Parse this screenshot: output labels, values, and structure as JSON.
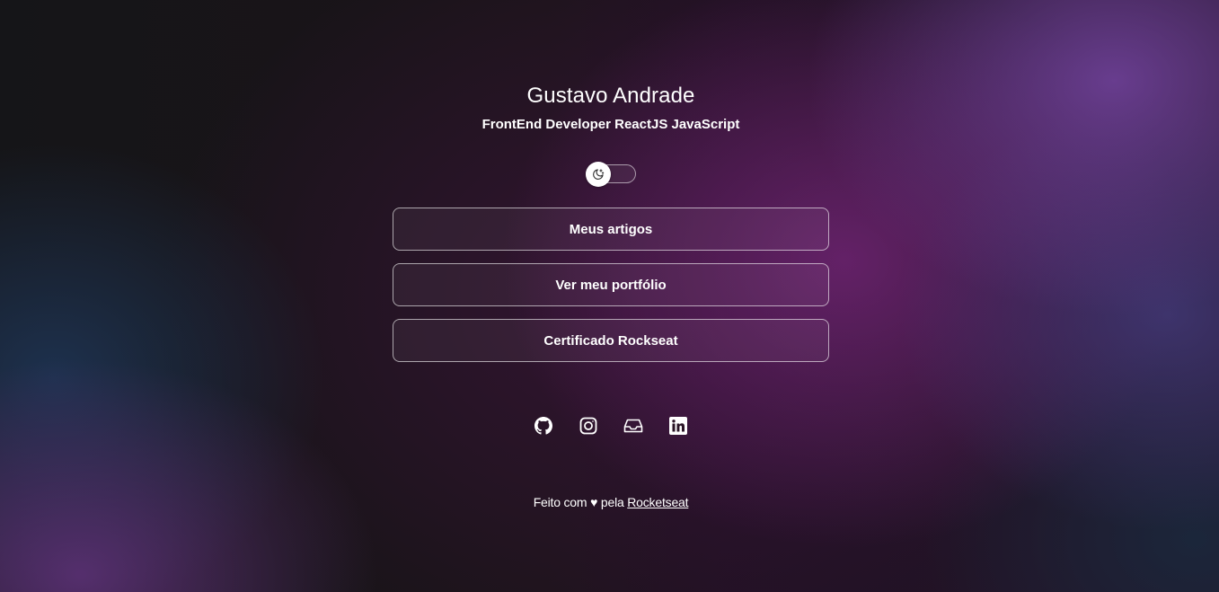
{
  "profile": {
    "name": "Gustavo Andrade",
    "role": "FrontEnd Developer ReactJS JavaScript"
  },
  "theme_switch": {
    "icon": "moon-stars-icon",
    "state": "off"
  },
  "links": [
    {
      "label": "Meus artigos"
    },
    {
      "label": "Ver meu portfólio"
    },
    {
      "label": "Certificado Rockseat"
    }
  ],
  "social": [
    {
      "icon": "github-icon"
    },
    {
      "icon": "instagram-icon"
    },
    {
      "icon": "inbox-icon"
    },
    {
      "icon": "linkedin-icon"
    }
  ],
  "footer": {
    "prefix": "Feito com",
    "heart": "♥",
    "middle": "pela",
    "link_label": "Rocketseat"
  }
}
